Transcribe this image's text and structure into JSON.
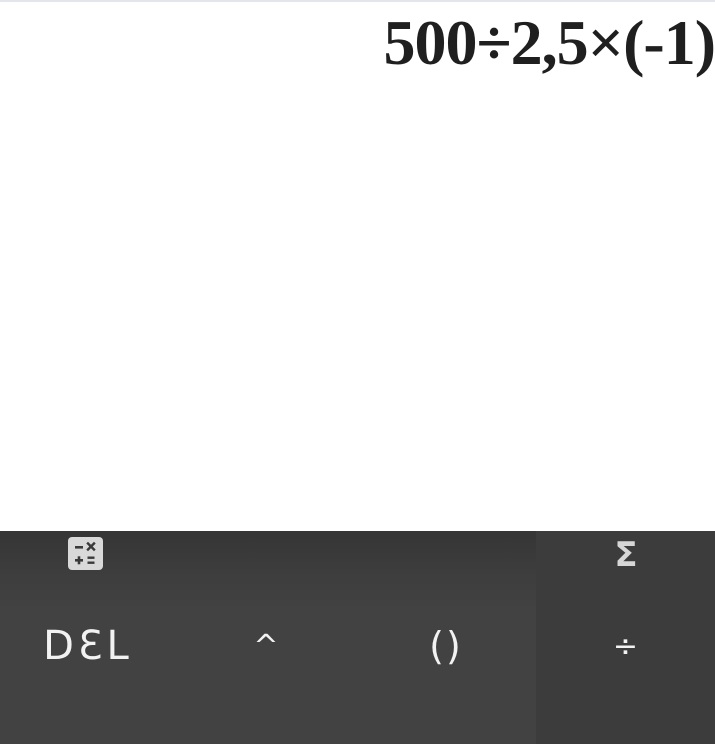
{
  "display": {
    "expression": "500÷2,5×(-1)"
  },
  "tabs": {
    "calculator_icon": "calculator-icon",
    "functions_icon": "Σ"
  },
  "keypad": {
    "del_label": "DƐL",
    "power_label": "^",
    "parentheses_label": "()",
    "divide_label": "÷"
  },
  "colors": {
    "display_background": "#ffffff",
    "expression_text": "#1f1f1f",
    "keypad_background": "#424242",
    "keypad_side_background": "#3c3c3c",
    "key_text": "#f2f2f2",
    "icon": "#d9d9d9"
  }
}
